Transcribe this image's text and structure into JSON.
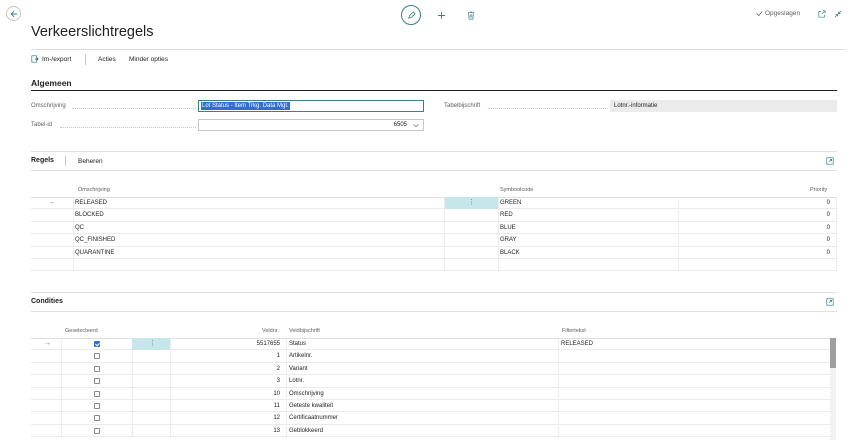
{
  "topbar": {
    "back_icon": "arrow-left-icon",
    "status": "Opgeslagen"
  },
  "page": {
    "title": "Verkeerslichtregels"
  },
  "actions": {
    "import_export": "Im-/export",
    "actions": "Acties",
    "fewer": "Minder opties"
  },
  "general": {
    "heading": "Algemeen",
    "description_label": "Omschrijving",
    "description_value": "Lot Status - Item Trkg. Data Mgt.",
    "table_id_label": "Tabel-id",
    "table_id_value": "6505",
    "table_caption_label": "Tabelbijschrift",
    "table_caption_value": "Lotnr.-informatie"
  },
  "rules": {
    "tab_rules": "Regels",
    "tab_manage": "Beheren",
    "columns": {
      "description": "Omschrijving",
      "symbol": "Symboolcode",
      "priority": "Priority"
    },
    "rows": [
      {
        "description": "RELEASED",
        "symbol": "GREEN",
        "priority": "0"
      },
      {
        "description": "BLOCKED",
        "symbol": "RED",
        "priority": "0"
      },
      {
        "description": "QC",
        "symbol": "BLUE",
        "priority": "0"
      },
      {
        "description": "QC_FINISHED",
        "symbol": "GRAY",
        "priority": "0"
      },
      {
        "description": "QUARANTINE",
        "symbol": "BLACK",
        "priority": "0"
      }
    ]
  },
  "conditions": {
    "heading": "Condities",
    "columns": {
      "selected": "Geselecteerd",
      "field_no": "Veldnr.",
      "field_caption": "Veldbijschrift",
      "filter": "Filtertekst"
    },
    "rows": [
      {
        "selected": true,
        "field_no": "5517655",
        "caption": "Status",
        "filter": "RELEASED"
      },
      {
        "selected": false,
        "field_no": "1",
        "caption": "Artikelnr.",
        "filter": ""
      },
      {
        "selected": false,
        "field_no": "2",
        "caption": "Variant",
        "filter": ""
      },
      {
        "selected": false,
        "field_no": "3",
        "caption": "Lotnr.",
        "filter": ""
      },
      {
        "selected": false,
        "field_no": "10",
        "caption": "Omschrijving",
        "filter": ""
      },
      {
        "selected": false,
        "field_no": "11",
        "caption": "Geteste kwaliteit",
        "filter": ""
      },
      {
        "selected": false,
        "field_no": "12",
        "caption": "Certificaatnummer",
        "filter": ""
      },
      {
        "selected": false,
        "field_no": "13",
        "caption": "Geblokkeerd",
        "filter": ""
      }
    ]
  },
  "colors": {
    "accent": "#3a8088",
    "selection": "#2f6ed6",
    "rowHighlight": "#c6e6ec"
  }
}
